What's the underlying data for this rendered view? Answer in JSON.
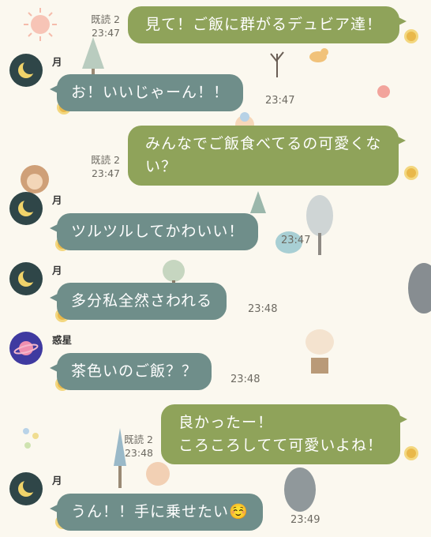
{
  "chat": {
    "messages": [
      {
        "type": "sent",
        "text_lines": [
          "見て！ご飯に群がるデュビア達！"
        ],
        "read": "既読 2",
        "time": "23:47"
      },
      {
        "type": "received",
        "sender": "月",
        "text_lines": [
          "お！いいじゃーん！！"
        ],
        "time": "23:47"
      },
      {
        "type": "sent",
        "text_lines": [
          "みんなでご飯食べてるの可愛くな",
          "い？"
        ],
        "read": "既読 2",
        "time": "23:47"
      },
      {
        "type": "received",
        "sender": "月",
        "text_lines": [
          "ツルツルしてかわいい！"
        ],
        "time": "23:47"
      },
      {
        "type": "received",
        "sender": "月",
        "text_lines": [
          "多分私全然さわれる"
        ],
        "time": "23:48"
      },
      {
        "type": "received",
        "sender": "惑星",
        "text_lines": [
          "茶色いのご飯？？"
        ],
        "time": "23:48"
      },
      {
        "type": "sent",
        "text_lines": [
          "良かったー！",
          "ころころしてて可愛いよね！"
        ],
        "read": "既読 2",
        "time": "23:48"
      },
      {
        "type": "received",
        "sender": "月",
        "text_lines": [
          "うん！！手に乗せたい☺️"
        ],
        "time": "23:49"
      }
    ]
  },
  "icons": {
    "moon_avatar": "crescent-moon-icon",
    "planet_avatar": "planet-icon"
  },
  "colors": {
    "sent_bubble": "#8fa35a",
    "received_bubble": "#6f8e8a",
    "background": "#fbf8ef",
    "moon_avatar_bg": "#2f4648",
    "planet_avatar_bg": "#3f3aa0"
  }
}
